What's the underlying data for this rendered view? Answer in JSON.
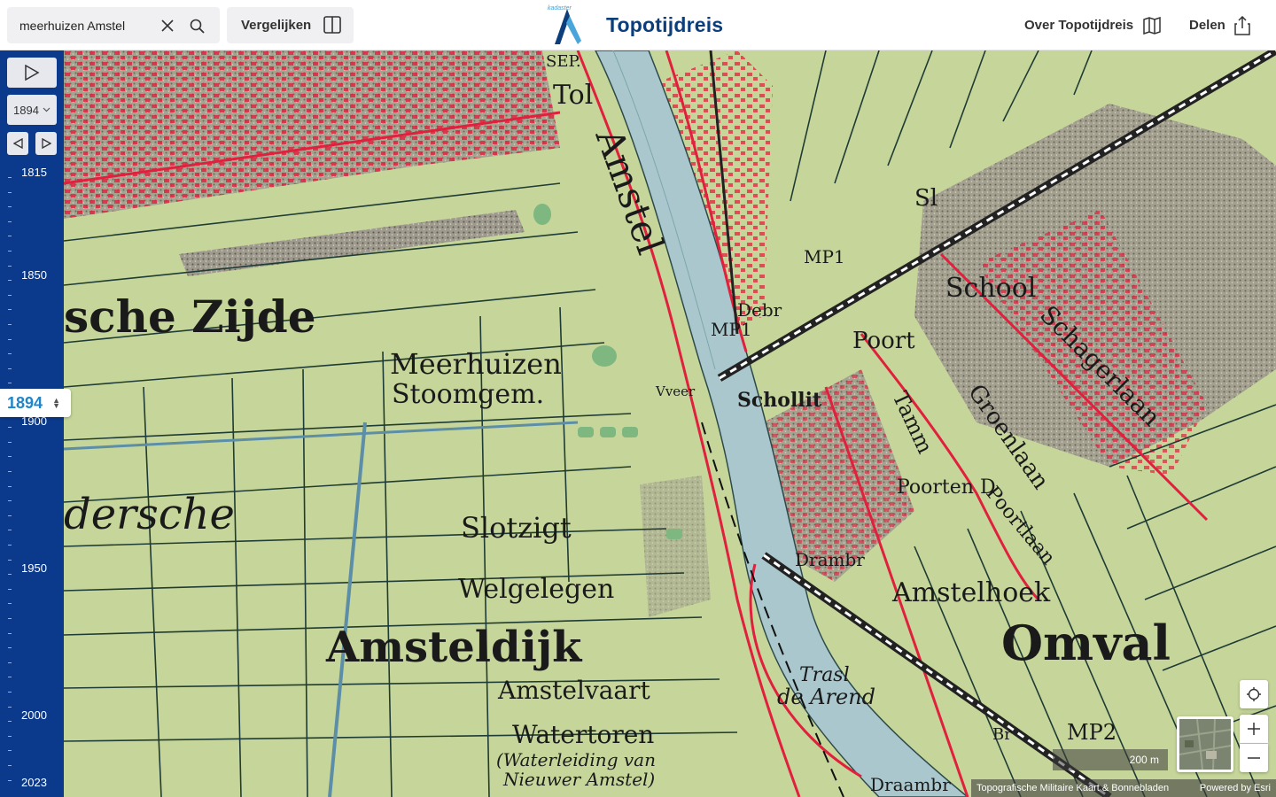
{
  "header": {
    "search_value": "meerhuizen Amstel",
    "compare_label": "Vergelijken",
    "kadaster": "kadaster",
    "brand": "Topotijdreis",
    "about_label": "Over Topotijdreis",
    "share_label": "Delen"
  },
  "timeline": {
    "selected_year": "1894",
    "current_year": "1894",
    "labels": [
      "1815",
      "1850",
      "1900",
      "1950",
      "2000",
      "2023"
    ]
  },
  "map": {
    "labels": [
      "Tol",
      "SEP.",
      "Amstel",
      "sche Zijde",
      "Meerhuizen",
      "Stoomgem.",
      "Vveer",
      "Schollit",
      "MP1",
      "Debr",
      "MP1",
      "Sl",
      "School",
      "Poort",
      "Schagerlaan",
      "Groenlaan",
      "Tamm",
      "Poortlaan",
      "Poorten D",
      "dersche",
      "Slotzigt",
      "Welgelegen",
      "Amsteldijk",
      "Amstelvaart",
      "Watertoren",
      "(Waterleiding van",
      "Nieuwer Amstel)",
      "Drambr",
      "Amstelhoek",
      "Omval",
      "Trasl",
      "de Arend",
      "MP2",
      "Br",
      "Draambr"
    ]
  },
  "controls": {
    "scale_label": "200 m",
    "attribution": "Topografische Militaire Kaart & Bonnebladen",
    "powered_by": "Powered by Esri"
  },
  "colors": {
    "sidebar": "#0b3a8c",
    "accent": "#1f86c9",
    "brand": "#0b3e7a",
    "map_green": "#c9d79d",
    "map_water": "#a9c7cc",
    "map_red": "#e0203c"
  }
}
